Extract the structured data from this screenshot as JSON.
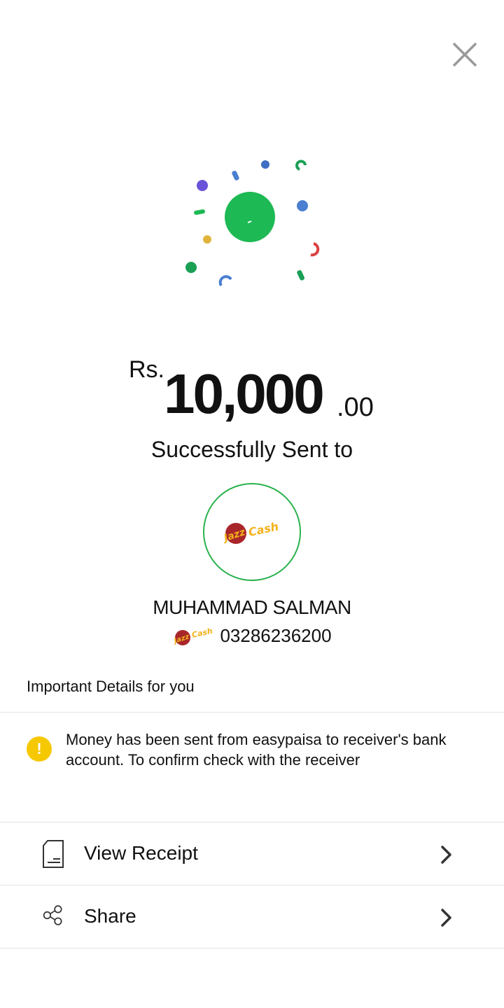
{
  "close": {
    "icon": "close-icon"
  },
  "amount": {
    "currency": "Rs.",
    "whole": "10,000",
    "decimal": ".00"
  },
  "status": "Successfully Sent to",
  "recipient": {
    "logo": "jazzcash-logo",
    "name": "MUHAMMAD SALMAN",
    "account": "03286236200"
  },
  "details": {
    "title": "Important Details for you",
    "notice": "Money has been sent from easypaisa to receiver's bank account. To confirm check with the receiver"
  },
  "actions": [
    {
      "label": "View Receipt",
      "icon": "receipt-icon"
    },
    {
      "label": "Share",
      "icon": "share-icon"
    }
  ],
  "colors": {
    "accent_green": "#1db954",
    "warning_yellow": "#f6c800",
    "divider": "#e4e4e4"
  }
}
